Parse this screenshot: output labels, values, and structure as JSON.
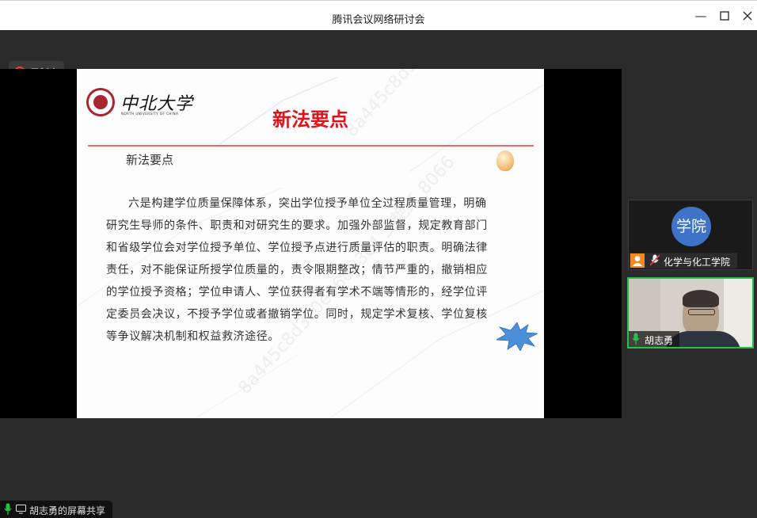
{
  "window": {
    "title": "腾讯会议网络研讨会",
    "minimize_icon": "minimize-icon",
    "maximize_icon": "maximize-icon",
    "close_icon": "close-icon"
  },
  "recording": {
    "label": "录制中",
    "color": "#e54545"
  },
  "slide": {
    "logo_name": "中北大学",
    "logo_subtitle": "NORTH UNIVERSITY OF CHINA",
    "title": "新法要点",
    "subheading": "新法要点",
    "body_lines": [
      "六是构建学位质量保障体系，突出学位授予单位全过程质量管理，明确",
      "研究生导师的条件、职责和对研究生的要求。加强外部监督，规定教育部门",
      "和省级学位会对学位授予单位、学位授予点进行质量评估的职责。明确法律",
      "责任，对不能保证所授学位质量的，责令限期整改；情节严重的，撤销相应",
      "的学位授予资格；学位申请人、学位获得者有学术不端等情形的，经学位评",
      "定委员会决议，不授予学位或者撤销学位。同时，规定学术复核、学位复核",
      "等争议解决机制和权益救济途径。"
    ],
    "watermark_1": "8a445c8d3c0e06d83c4 王艳红 8066",
    "watermark_2": "8a445c8d3c0e06d83c4 王艳红 8066",
    "title_color": "#e0121b"
  },
  "share_status": {
    "label": "胡志勇的屏幕共享"
  },
  "participants": [
    {
      "avatar_text": "学院",
      "name": "化学与化工学院",
      "avatar_color": "#3e73c8"
    },
    {
      "name": "胡志勇",
      "speaking_border": "#27c04a"
    }
  ]
}
